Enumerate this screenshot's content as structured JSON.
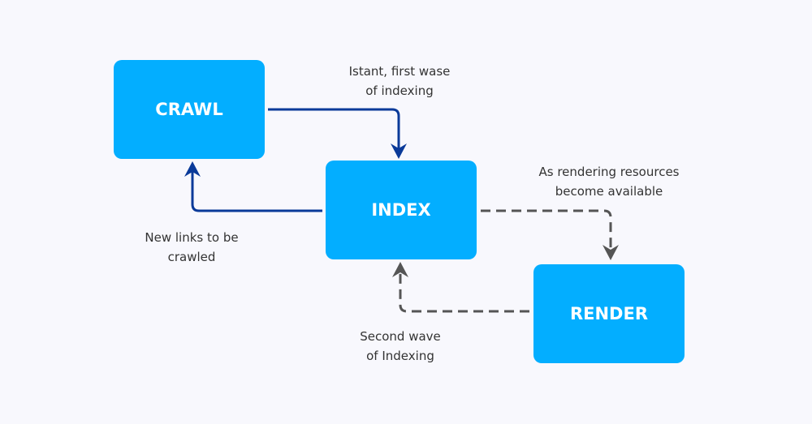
{
  "nodes": {
    "crawl": "CRAWL",
    "index": "INDEX",
    "render": "RENDER"
  },
  "edges": {
    "crawl_to_index": {
      "line1": "Istant, first wase",
      "line2": "of indexing"
    },
    "index_to_crawl": {
      "line1": "New links to be",
      "line2": "crawled"
    },
    "index_to_render": {
      "line1": "As rendering resources",
      "line2": "become available"
    },
    "render_to_index": {
      "line1": "Second wave",
      "line2": "of Indexing"
    }
  },
  "colors": {
    "node": "#03aeff",
    "solid_arrow": "#0a3a99",
    "dashed_arrow": "#555555",
    "background": "#f8f8fd"
  }
}
